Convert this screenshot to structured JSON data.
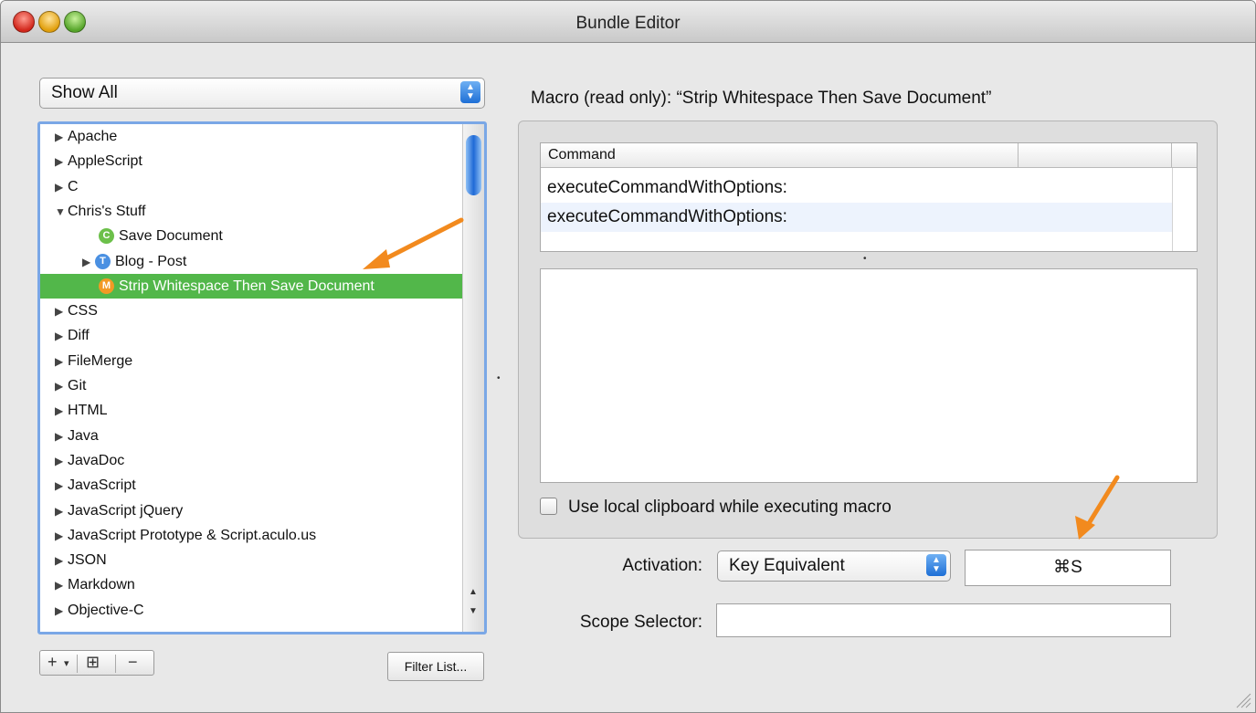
{
  "window": {
    "title": "Bundle Editor"
  },
  "filter": {
    "selected": "Show All"
  },
  "bundles": [
    {
      "label": "Apache",
      "level": 0,
      "expanded": false
    },
    {
      "label": "AppleScript",
      "level": 0,
      "expanded": false
    },
    {
      "label": "C",
      "level": 0,
      "expanded": false
    },
    {
      "label": "Chris's Stuff",
      "level": 0,
      "expanded": true
    },
    {
      "label": "Save Document",
      "level": 1,
      "badge": "C",
      "badge_kind": "c"
    },
    {
      "label": "Blog - Post",
      "level": 1,
      "badge": "T",
      "badge_kind": "t",
      "expandable": true
    },
    {
      "label": "Strip Whitespace Then Save Document",
      "level": 1,
      "badge": "M",
      "badge_kind": "m",
      "selected": true
    },
    {
      "label": "CSS",
      "level": 0,
      "expanded": false
    },
    {
      "label": "Diff",
      "level": 0,
      "expanded": false
    },
    {
      "label": "FileMerge",
      "level": 0,
      "expanded": false
    },
    {
      "label": "Git",
      "level": 0,
      "expanded": false
    },
    {
      "label": "HTML",
      "level": 0,
      "expanded": false
    },
    {
      "label": "Java",
      "level": 0,
      "expanded": false
    },
    {
      "label": "JavaDoc",
      "level": 0,
      "expanded": false
    },
    {
      "label": "JavaScript",
      "level": 0,
      "expanded": false
    },
    {
      "label": "JavaScript jQuery",
      "level": 0,
      "expanded": false
    },
    {
      "label": "JavaScript Prototype & Script.aculo.us",
      "level": 0,
      "expanded": false
    },
    {
      "label": "JSON",
      "level": 0,
      "expanded": false
    },
    {
      "label": "Markdown",
      "level": 0,
      "expanded": false
    },
    {
      "label": "Objective-C",
      "level": 0,
      "expanded": false
    }
  ],
  "bottom_buttons": {
    "add": "+",
    "add_menu": "▾",
    "add_group": "⊞",
    "remove": "−",
    "filter_list": "Filter List..."
  },
  "macro": {
    "title": "Macro (read only): “Strip Whitespace Then Save Document”",
    "column_header": "Command",
    "commands": [
      "executeCommandWithOptions:",
      "executeCommandWithOptions:"
    ],
    "use_local_clipboard_label": "Use local clipboard while executing macro",
    "use_local_clipboard_checked": false
  },
  "activation": {
    "label": "Activation:",
    "selected": "Key Equivalent",
    "key": "⌘S"
  },
  "scope": {
    "label": "Scope Selector:",
    "value": ""
  },
  "colors": {
    "selection": "#52b74a",
    "annotation_arrow": "#f28a1e",
    "focus_ring": "#7aa7e6"
  },
  "icons": [
    "close-button",
    "minimize-button",
    "zoom-button",
    "disclosure-triangle-icon",
    "popup-stepper-icon",
    "annotation-arrow",
    "resize-grip-icon"
  ]
}
